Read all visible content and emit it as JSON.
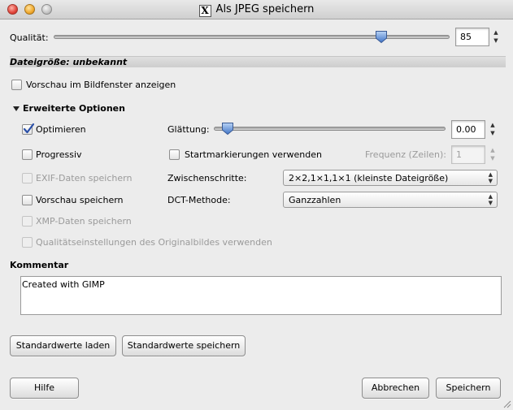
{
  "window": {
    "title": "Als JPEG speichern"
  },
  "quality": {
    "label": "Qualität:",
    "value": "85",
    "level_percent": 85
  },
  "filesize": {
    "label": "Dateigröße: unbekannt"
  },
  "preview_checkbox": {
    "label": "Vorschau im Bildfenster anzeigen",
    "checked": false
  },
  "advanced": {
    "label": "Erweiterte Optionen",
    "optimize": {
      "label": "Optimieren",
      "checked": true
    },
    "progressive": {
      "label": "Progressiv",
      "checked": false
    },
    "exif": {
      "label": "EXIF-Daten speichern",
      "checked": false
    },
    "thumbnail": {
      "label": "Vorschau speichern",
      "checked": false
    },
    "xmp": {
      "label": "XMP-Daten speichern",
      "checked": false
    },
    "original_quality": {
      "label": "Qualitätseinstellungen des Originalbildes verwenden",
      "checked": false
    },
    "smoothing": {
      "label": "Glättung:",
      "value": "0.00",
      "level_percent": 0
    },
    "restart_markers": {
      "label": "Startmarkierungen verwenden",
      "checked": false
    },
    "frequency": {
      "label": "Frequenz (Zeilen):",
      "value": "1"
    },
    "subsampling": {
      "label": "Zwischenschritte:",
      "selected": "2×2,1×1,1×1 (kleinste Dateigröße)"
    },
    "dct": {
      "label": "DCT-Methode:",
      "selected": "Ganzzahlen"
    }
  },
  "comment": {
    "label": "Kommentar",
    "value": "Created with GIMP"
  },
  "buttons": {
    "load_defaults": "Standardwerte laden",
    "save_defaults": "Standardwerte speichern",
    "help": "Hilfe",
    "cancel": "Abbrechen",
    "save": "Speichern"
  },
  "colors": {
    "check_blue": "#2a4fa8"
  }
}
